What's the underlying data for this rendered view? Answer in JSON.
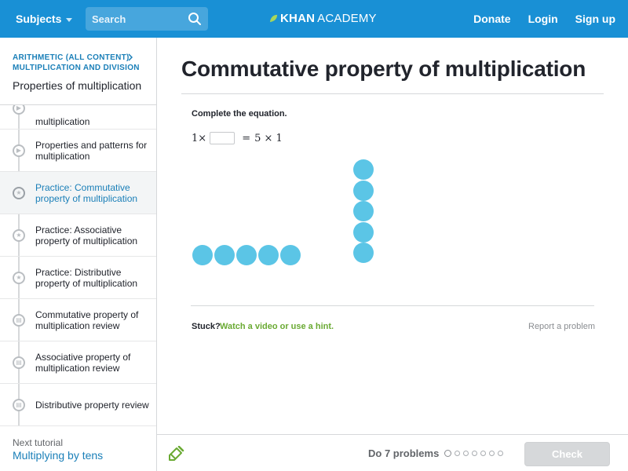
{
  "header": {
    "subjects_label": "Subjects",
    "search_placeholder": "Search",
    "logo_bold": "KHAN",
    "logo_light": "ACADEMY",
    "links": [
      "Donate",
      "Login",
      "Sign up"
    ],
    "bar_color": "#1990d5"
  },
  "sidebar": {
    "breadcrumb_1": "ARITHMETIC (ALL CONTENT)",
    "breadcrumb_2": "MULTIPLICATION AND DIVISION",
    "title": "Properties of multiplication",
    "items": [
      {
        "label": "multiplication",
        "icon": "play-icon"
      },
      {
        "label": "Properties and patterns for multiplication",
        "icon": "play-icon"
      },
      {
        "label": "Practice: Commutative property of multiplication",
        "icon": "star-icon",
        "active": true
      },
      {
        "label": "Practice: Associative property of multiplication",
        "icon": "star-icon"
      },
      {
        "label": "Practice: Distributive property of multiplication",
        "icon": "star-icon"
      },
      {
        "label": "Commutative property of multiplication review",
        "icon": "document-icon"
      },
      {
        "label": "Associative property of multiplication review",
        "icon": "document-icon"
      },
      {
        "label": "Distributive property review",
        "icon": "document-icon"
      }
    ],
    "next_label": "Next tutorial",
    "next_link": "Multiplying by tens"
  },
  "main": {
    "title": "Commutative property of multiplication",
    "instruction": "Complete the equation.",
    "equation": {
      "left_factor": "1",
      "times": "×",
      "equals": "=",
      "right": "5 × 1",
      "answer": ""
    },
    "dots": {
      "horizontal_count": 5,
      "vertical_count": 5,
      "color": "#5bc5e6"
    },
    "stuck_label": "Stuck?",
    "hint_link": "Watch a video or use a hint.",
    "report_link": "Report a problem"
  },
  "footer": {
    "do_label": "Do 7 problems",
    "problem_count": 7,
    "check_label": "Check"
  }
}
